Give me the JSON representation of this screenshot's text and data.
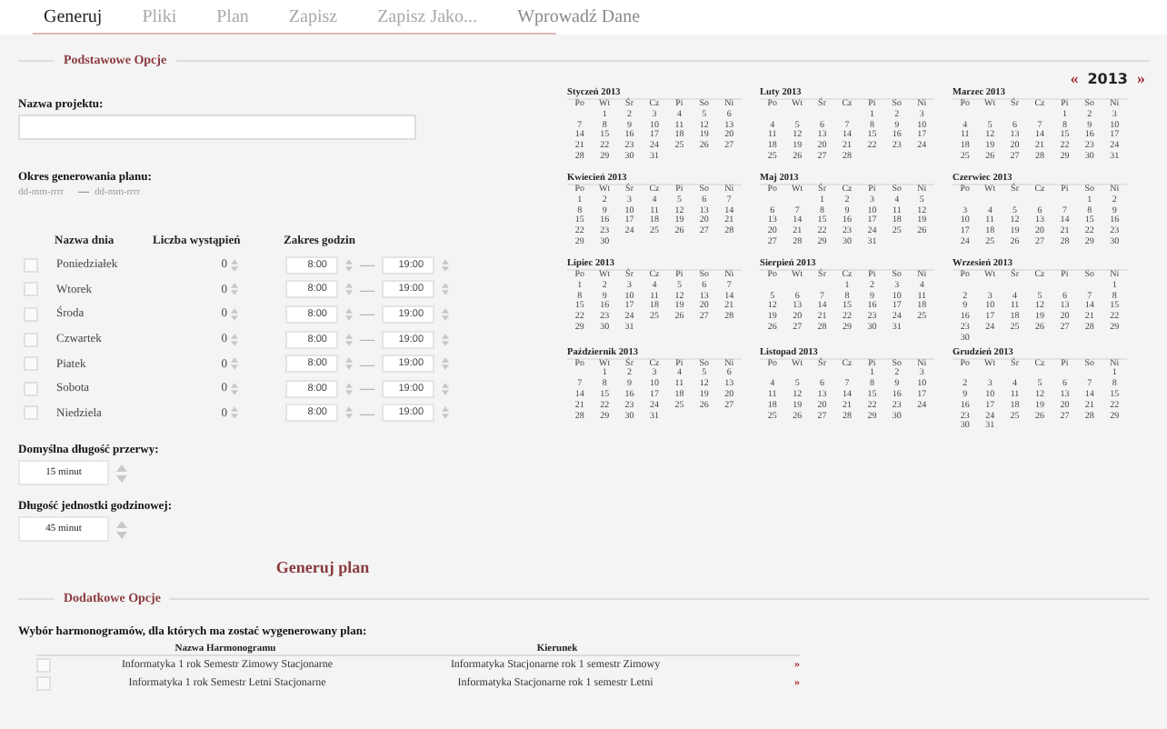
{
  "tabs": [
    {
      "label": "Generuj",
      "selected": true,
      "disabled": false
    },
    {
      "label": "Pliki",
      "selected": false,
      "disabled": true
    },
    {
      "label": "Plan",
      "selected": false,
      "disabled": true
    },
    {
      "label": "Zapisz",
      "selected": false,
      "disabled": true
    },
    {
      "label": "Zapisz Jako...",
      "selected": false,
      "disabled": true
    },
    {
      "label": "Wprowadź Dane",
      "selected": false,
      "disabled": false
    }
  ],
  "basic": {
    "legend": "Podstawowe Opcje",
    "project_label": "Nazwa projektu:",
    "period_label": "Okres generowania planu:",
    "date_from": {
      "placeholder": "dd-mm-rrrr"
    },
    "date_sep": "—",
    "date_to": {
      "placeholder": "dd-mm-rrrr"
    },
    "columns": [
      "Nazwa dnia",
      "Liczba wystąpień",
      "Zakres godzin"
    ],
    "days": [
      {
        "name": "Poniedziałek",
        "checked": false,
        "count": "0",
        "from": "8:00",
        "sep": "—",
        "to": "19:00"
      },
      {
        "name": "Wtorek",
        "checked": false,
        "count": "0",
        "from": "8:00",
        "sep": "—",
        "to": "19:00"
      },
      {
        "name": "Środa",
        "checked": false,
        "count": "0",
        "from": "8:00",
        "sep": "—",
        "to": "19:00"
      },
      {
        "name": "Czwartek",
        "checked": false,
        "count": "0",
        "from": "8:00",
        "sep": "—",
        "to": "19:00"
      },
      {
        "name": "Piatek",
        "checked": false,
        "count": "0",
        "from": "8:00",
        "sep": "—",
        "to": "19:00"
      },
      {
        "name": "Sobota",
        "checked": false,
        "count": "0",
        "from": "8:00",
        "sep": "—",
        "to": "19:00"
      },
      {
        "name": "Niedziela",
        "checked": false,
        "count": "0",
        "from": "8:00",
        "sep": "—",
        "to": "19:00"
      }
    ],
    "break_label": "Domyślna długość przerwy:",
    "break_value": "15 minut",
    "unit_label": "Długość jednostki godzinowej:",
    "unit_value": "45 minut",
    "generate_button": "Generuj plan"
  },
  "calendar": {
    "prev": "«",
    "year": "2013",
    "next": "»",
    "months": [
      {
        "title": "Styczeń 2013",
        "weekdays": [
          "Po",
          "Wt",
          "Śr",
          "Cz",
          "Pi",
          "So",
          "Ni"
        ],
        "weeks": [
          [
            "1",
            "2",
            "3",
            "4",
            "5",
            "6"
          ],
          [
            "7",
            "8",
            "9",
            "10",
            "11",
            "12",
            "13"
          ],
          [
            "14",
            "15",
            "16",
            "17",
            "18",
            "19",
            "20"
          ],
          [
            "21",
            "22",
            "23",
            "24",
            "25",
            "26",
            "27"
          ],
          [
            "28",
            "29",
            "30",
            "31"
          ]
        ]
      },
      {
        "title": "Luty 2013",
        "weekdays": [
          "Po",
          "Wt",
          "Śr",
          "Cz",
          "Pi",
          "So",
          "Ni"
        ],
        "weeks": [
          [
            "1",
            "2",
            "3"
          ],
          [
            "4",
            "5",
            "6",
            "7",
            "8",
            "9",
            "10"
          ],
          [
            "11",
            "12",
            "13",
            "14",
            "15",
            "16",
            "17"
          ],
          [
            "18",
            "19",
            "20",
            "21",
            "22",
            "23",
            "24"
          ],
          [
            "25",
            "26",
            "27",
            "28"
          ]
        ]
      },
      {
        "title": "Marzec 2013",
        "weekdays": [
          "Po",
          "Wt",
          "Śr",
          "Cz",
          "Pi",
          "So",
          "Ni"
        ],
        "weeks": [
          [
            "1",
            "2",
            "3"
          ],
          [
            "4",
            "5",
            "6",
            "7",
            "8",
            "9",
            "10"
          ],
          [
            "11",
            "12",
            "13",
            "14",
            "15",
            "16",
            "17"
          ],
          [
            "18",
            "19",
            "20",
            "21",
            "22",
            "23",
            "24"
          ],
          [
            "25",
            "26",
            "27",
            "28",
            "29",
            "30",
            "31"
          ]
        ]
      },
      {
        "title": "Kwiecień 2013",
        "weekdays": [
          "Po",
          "Wt",
          "Śr",
          "Cz",
          "Pi",
          "So",
          "Ni"
        ],
        "weeks": [
          [
            "1",
            "2",
            "3",
            "4",
            "5",
            "6",
            "7"
          ],
          [
            "8",
            "9",
            "10",
            "11",
            "12",
            "13",
            "14"
          ],
          [
            "15",
            "16",
            "17",
            "18",
            "19",
            "20",
            "21"
          ],
          [
            "22",
            "23",
            "24",
            "25",
            "26",
            "27",
            "28"
          ],
          [
            "29",
            "30"
          ]
        ]
      },
      {
        "title": "Maj 2013",
        "weekdays": [
          "Po",
          "Wt",
          "Śr",
          "Cz",
          "Pi",
          "So",
          "Ni"
        ],
        "weeks": [
          [
            "1",
            "2",
            "3",
            "4",
            "5"
          ],
          [
            "6",
            "7",
            "8",
            "9",
            "10",
            "11",
            "12"
          ],
          [
            "13",
            "14",
            "15",
            "16",
            "17",
            "18",
            "19"
          ],
          [
            "20",
            "21",
            "22",
            "23",
            "24",
            "25",
            "26"
          ],
          [
            "27",
            "28",
            "29",
            "30",
            "31"
          ]
        ]
      },
      {
        "title": "Czerwiec 2013",
        "weekdays": [
          "Po",
          "Wt",
          "Śr",
          "Cz",
          "Pi",
          "So",
          "Ni"
        ],
        "weeks": [
          [
            "1",
            "2"
          ],
          [
            "3",
            "4",
            "5",
            "6",
            "7",
            "8",
            "9"
          ],
          [
            "10",
            "11",
            "12",
            "13",
            "14",
            "15",
            "16"
          ],
          [
            "17",
            "18",
            "19",
            "20",
            "21",
            "22",
            "23"
          ],
          [
            "24",
            "25",
            "26",
            "27",
            "28",
            "29",
            "30"
          ]
        ]
      },
      {
        "title": "Lipiec 2013",
        "weekdays": [
          "Po",
          "Wt",
          "Śr",
          "Cz",
          "Pi",
          "So",
          "Ni"
        ],
        "weeks": [
          [
            "1",
            "2",
            "3",
            "4",
            "5",
            "6",
            "7"
          ],
          [
            "8",
            "9",
            "10",
            "11",
            "12",
            "13",
            "14"
          ],
          [
            "15",
            "16",
            "17",
            "18",
            "19",
            "20",
            "21"
          ],
          [
            "22",
            "23",
            "24",
            "25",
            "26",
            "27",
            "28"
          ],
          [
            "29",
            "30",
            "31"
          ]
        ]
      },
      {
        "title": "Sierpień 2013",
        "weekdays": [
          "Po",
          "Wt",
          "Śr",
          "Cz",
          "Pi",
          "So",
          "Ni"
        ],
        "weeks": [
          [
            "1",
            "2",
            "3",
            "4"
          ],
          [
            "5",
            "6",
            "7",
            "8",
            "9",
            "10",
            "11"
          ],
          [
            "12",
            "13",
            "14",
            "15",
            "16",
            "17",
            "18"
          ],
          [
            "19",
            "20",
            "21",
            "22",
            "23",
            "24",
            "25"
          ],
          [
            "26",
            "27",
            "28",
            "29",
            "30",
            "31"
          ]
        ]
      },
      {
        "title": "Wrzesień 2013",
        "weekdays": [
          "Po",
          "Wt",
          "Śr",
          "Cz",
          "Pi",
          "So",
          "Ni"
        ],
        "weeks": [
          [
            "1"
          ],
          [
            "2",
            "3",
            "4",
            "5",
            "6",
            "7",
            "8"
          ],
          [
            "9",
            "10",
            "11",
            "12",
            "13",
            "14",
            "15"
          ],
          [
            "16",
            "17",
            "18",
            "19",
            "20",
            "21",
            "22"
          ],
          [
            "23",
            "24",
            "25",
            "26",
            "27",
            "28",
            "29"
          ],
          [
            "30"
          ]
        ]
      },
      {
        "title": "Październik 2013",
        "weekdays": [
          "Po",
          "Wt",
          "Śr",
          "Cz",
          "Pi",
          "So",
          "Ni"
        ],
        "weeks": [
          [
            "1",
            "2",
            "3",
            "4",
            "5",
            "6"
          ],
          [
            "7",
            "8",
            "9",
            "10",
            "11",
            "12",
            "13"
          ],
          [
            "14",
            "15",
            "16",
            "17",
            "18",
            "19",
            "20"
          ],
          [
            "21",
            "22",
            "23",
            "24",
            "25",
            "26",
            "27"
          ],
          [
            "28",
            "29",
            "30",
            "31"
          ]
        ]
      },
      {
        "title": "Listopad 2013",
        "weekdays": [
          "Po",
          "Wt",
          "Śr",
          "Cz",
          "Pi",
          "So",
          "Ni"
        ],
        "weeks": [
          [
            "1",
            "2",
            "3"
          ],
          [
            "4",
            "5",
            "6",
            "7",
            "8",
            "9",
            "10"
          ],
          [
            "11",
            "12",
            "13",
            "14",
            "15",
            "16",
            "17"
          ],
          [
            "18",
            "19",
            "20",
            "21",
            "22",
            "23",
            "24"
          ],
          [
            "25",
            "26",
            "27",
            "28",
            "29",
            "30"
          ]
        ]
      },
      {
        "title": "Grudzień 2013",
        "weekdays": [
          "Po",
          "Wt",
          "Śr",
          "Cz",
          "Pi",
          "So",
          "Ni"
        ],
        "weeks": [
          [
            "1"
          ],
          [
            "2",
            "3",
            "4",
            "5",
            "6",
            "7",
            "8"
          ],
          [
            "9",
            "10",
            "11",
            "12",
            "13",
            "14",
            "15"
          ],
          [
            "16",
            "17",
            "18",
            "19",
            "20",
            "21",
            "22"
          ],
          [
            "23",
            "24",
            "25",
            "26",
            "27",
            "28",
            "29"
          ],
          [
            "30",
            "31"
          ]
        ]
      }
    ]
  },
  "extra": {
    "legend": "Dodatkowe Opcje",
    "schedules_label": "Wybór harmonogramów, dla których ma zostać wygenerowany plan:",
    "columns": [
      "Nazwa Harmonogramu",
      "Kierunek"
    ],
    "rows": [
      {
        "checked": false,
        "name": "Informatyka 1 rok Semestr Zimowy Stacjonarne",
        "field": "Informatyka Stacjonarne rok 1 semestr Zimowy",
        "link": "»"
      },
      {
        "checked": false,
        "name": "Informatyka 1 rok Semestr Letni Stacjonarne",
        "field": "Informatyka Stacjonarne rok 1 semestr Letni",
        "link": "»"
      }
    ]
  }
}
